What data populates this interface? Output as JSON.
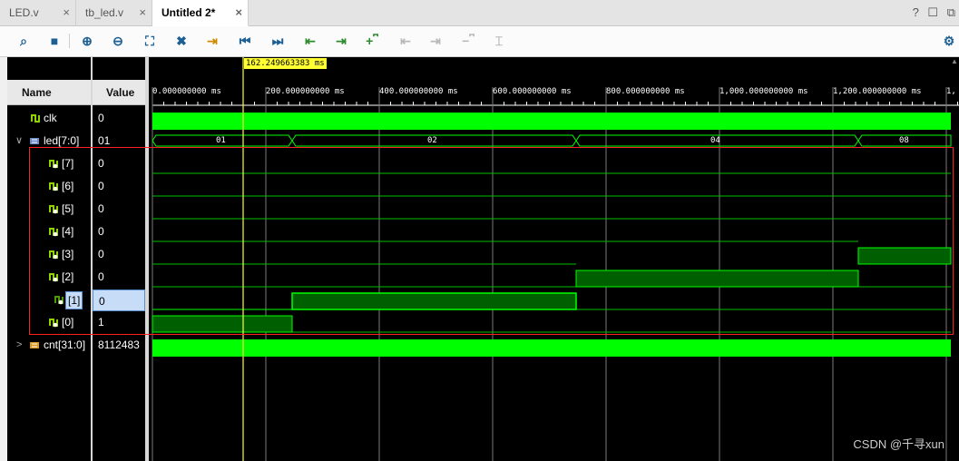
{
  "tabs": [
    {
      "label": "LED.v",
      "active": false
    },
    {
      "label": "tb_led.v",
      "active": false
    },
    {
      "label": "Untitled 2*",
      "active": true
    }
  ],
  "tab_close_glyph": "×",
  "window_controls": {
    "help": "?",
    "restore": "☐",
    "float": "⧉"
  },
  "toolbar": {
    "icons": [
      "search-icon",
      "save-icon",
      "zoom-in-icon",
      "zoom-out-icon",
      "zoom-fit-icon",
      "cursor-icon",
      "go-to-cursor-icon",
      "go-to-start-icon",
      "go-to-end-icon",
      "previous-transition-icon",
      "next-transition-icon",
      "add-marker-icon",
      "previous-marker-icon",
      "next-marker-icon",
      "swap-cursors-icon",
      "snap-icon",
      "settings-icon"
    ]
  },
  "columns": {
    "name": "Name",
    "value": "Value"
  },
  "cursor": {
    "time_label": "162.249663383 ms"
  },
  "time_ticks": [
    "0.000000000 ms",
    "200.000000000 ms",
    "400.000000000 ms",
    "600.000000000 ms",
    "800.000000000 ms",
    "1,000.000000000 ms",
    "1,200.000000000 ms",
    "1,"
  ],
  "signals": [
    {
      "name": "clk",
      "value": "0",
      "expandable": false,
      "kind": "bit"
    },
    {
      "name": "led[7:0]",
      "value": "01",
      "expandable": true,
      "expanded": true,
      "kind": "bus"
    },
    {
      "name": "[7]",
      "value": "0",
      "kind": "bit",
      "child": true
    },
    {
      "name": "[6]",
      "value": "0",
      "kind": "bit",
      "child": true
    },
    {
      "name": "[5]",
      "value": "0",
      "kind": "bit",
      "child": true
    },
    {
      "name": "[4]",
      "value": "0",
      "kind": "bit",
      "child": true
    },
    {
      "name": "[3]",
      "value": "0",
      "kind": "bit",
      "child": true
    },
    {
      "name": "[2]",
      "value": "0",
      "kind": "bit",
      "child": true
    },
    {
      "name": "[1]",
      "value": "0",
      "kind": "bit",
      "child": true,
      "selected": true
    },
    {
      "name": "[0]",
      "value": "1",
      "kind": "bit",
      "child": true
    },
    {
      "name": "cnt[31:0]",
      "value": "8112483",
      "expandable": true,
      "expanded": false,
      "kind": "bus"
    }
  ],
  "bus_values": [
    "01",
    "02",
    "04",
    "08"
  ],
  "colors": {
    "wave_green": "#00ff00",
    "wave_fill": "#005f00",
    "cursor": "#ffff33",
    "highlight_box": "#ff2020"
  },
  "watermark": "CSDN @千寻xun"
}
